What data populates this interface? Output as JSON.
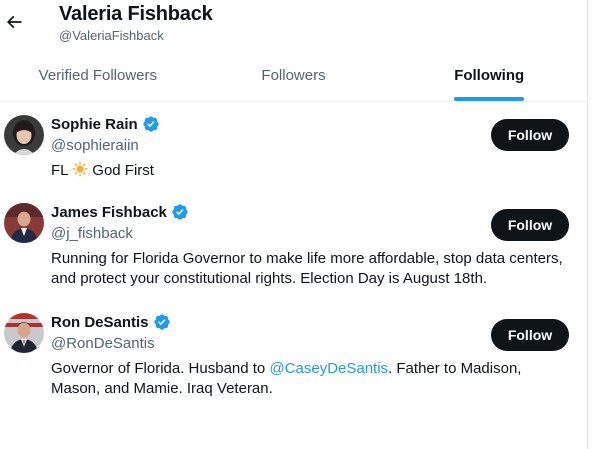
{
  "header": {
    "title": "Valeria Fishback",
    "handle": "@ValeriaFishback"
  },
  "tabs": [
    {
      "label": "Verified Followers",
      "active": false
    },
    {
      "label": "Followers",
      "active": false
    },
    {
      "label": "Following",
      "active": true
    }
  ],
  "accounts": [
    {
      "name": "Sophie Rain",
      "handle": "@sophieraiin",
      "bio_pre": "FL ",
      "bio_emoji": "sun",
      "bio_post": " God First",
      "button": "Follow",
      "verified": true
    },
    {
      "name": "James Fishback",
      "handle": "@j_fishback",
      "bio": "Running for Florida Governor to make life more affordable, stop data centers, and protect your constitutional rights. Election Day is August 18th.",
      "button": "Follow",
      "verified": true
    },
    {
      "name": "Ron DeSantis",
      "handle": "@RonDeSantis",
      "bio_pre": "Governor of Florida. Husband to ",
      "bio_mention": "@CaseyDeSantis",
      "bio_post": ". Father to Madison, Mason, and Mamie. Iraq Veteran.",
      "button": "Follow",
      "verified": true
    }
  ],
  "colors": {
    "accent": "#1d9bf0",
    "text": "#0f1419",
    "secondary": "#536471",
    "button_bg": "#0f1419"
  },
  "icons": {
    "back": "arrow-left-icon",
    "verified": "verified-badge-icon",
    "sun": "sun-emoji-icon"
  }
}
